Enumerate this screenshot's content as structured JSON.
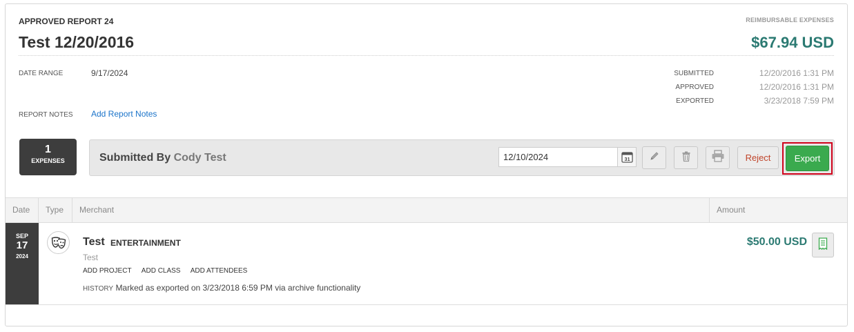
{
  "header": {
    "report_label": "APPROVED REPORT 24",
    "reimbursable_label": "REIMBURSABLE EXPENSES",
    "title": "Test 12/20/2016",
    "total": "$67.94 USD"
  },
  "meta": {
    "date_range_label": "DATE RANGE",
    "date_range_value": "9/17/2024",
    "report_notes_label": "REPORT NOTES",
    "add_notes_link": "Add Report Notes"
  },
  "timestamps": [
    {
      "label": "SUBMITTED",
      "value": "12/20/2016 1:31 PM"
    },
    {
      "label": "APPROVED",
      "value": "12/20/2016 1:31 PM"
    },
    {
      "label": "EXPORTED",
      "value": "3/23/2018 7:59 PM"
    }
  ],
  "expense_count": {
    "number": "1",
    "label": "EXPENSES"
  },
  "toolbar": {
    "submitted_by_label": "Submitted By",
    "submitted_by_name": "Cody Test",
    "date_value": "12/10/2024",
    "calendar_day": "31",
    "reject_label": "Reject",
    "export_label": "Export",
    "icons": [
      "calendar-icon",
      "pencil-icon",
      "trash-icon",
      "printer-icon"
    ]
  },
  "table": {
    "columns": [
      "Date",
      "Type",
      "Merchant",
      "Amount"
    ]
  },
  "expenses": [
    {
      "month": "SEP",
      "day": "17",
      "year": "2024",
      "type_icon": "theater-masks-icon",
      "merchant": "Test",
      "category": "ENTERTAINMENT",
      "description": "Test",
      "actions": [
        "ADD PROJECT",
        "ADD CLASS",
        "ADD ATTENDEES"
      ],
      "history_label": "HISTORY",
      "history_text": "Marked as exported on 3/23/2018 6:59 PM via archive functionality",
      "amount": "$50.00 USD",
      "receipt_icon": "receipt-icon"
    }
  ],
  "colors": {
    "accent_teal": "#2b7a72",
    "export_green": "#3aaa4e",
    "reject_red": "#c0442a",
    "link_blue": "#1a73c9",
    "highlight_red": "#d0021b"
  }
}
